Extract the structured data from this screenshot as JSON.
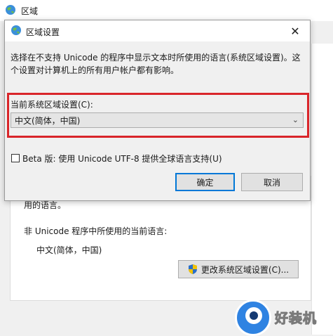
{
  "background_window": {
    "title": "区域",
    "partial_text": "用的语言。",
    "non_unicode_label": "非 Unicode 程序中所使用的当前语言:",
    "current_language": "中文(简体，中国)",
    "change_button_label": "更改系统区域设置(C)..."
  },
  "dialog": {
    "title": "区域设置",
    "description": "选择在不支持 Unicode 的程序中显示文本时所使用的语言(系统区域设置)。这个设置对计算机上的所有用户帐户都有影响。",
    "locale_label": "当前系统区域设置(C):",
    "locale_value": "中文(简体，中国)",
    "beta_label": "Beta 版: 使用 Unicode UTF-8 提供全球语言支持(U)",
    "beta_checked": false,
    "ok_label": "确定",
    "cancel_label": "取消",
    "close_glyph": "✕"
  },
  "watermark": {
    "text": "好装机"
  },
  "colors": {
    "highlight": "#d9252a",
    "focus_border": "#0078d7"
  }
}
